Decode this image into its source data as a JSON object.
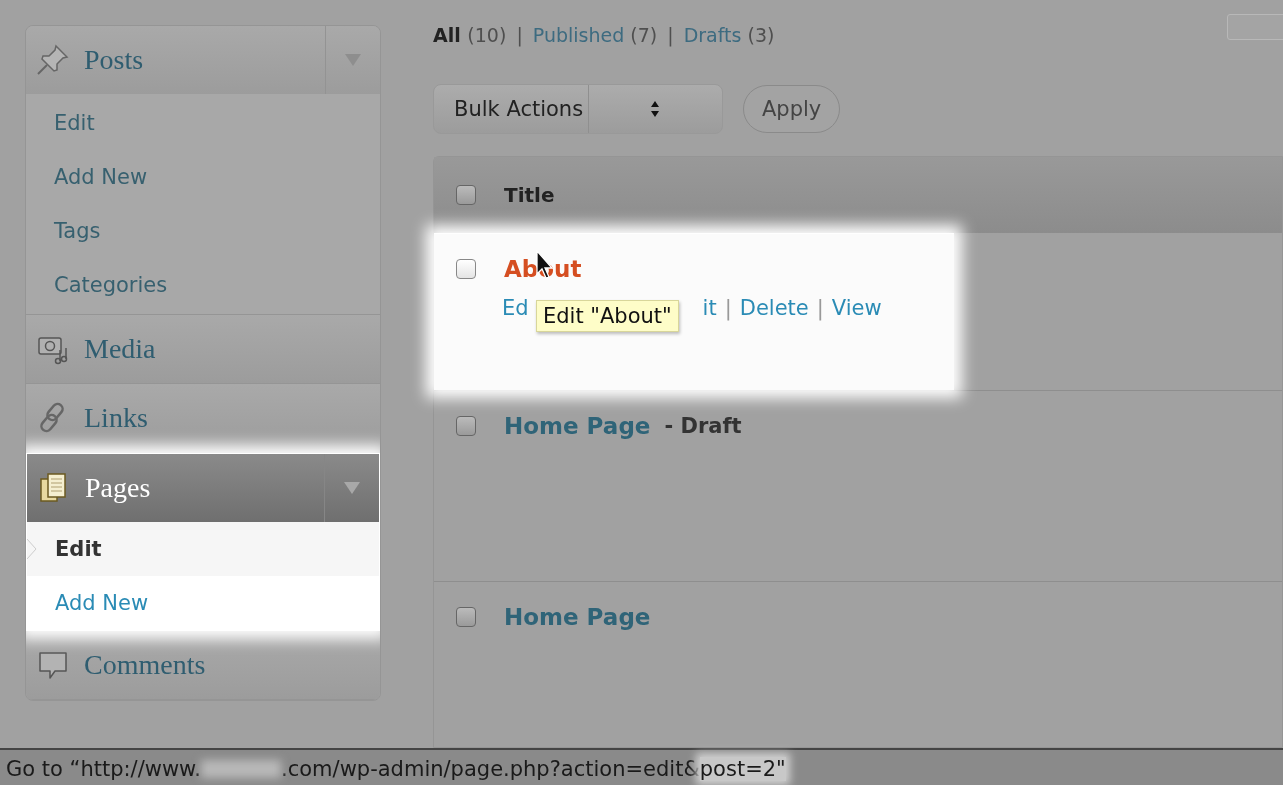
{
  "sidebar": {
    "groups": [
      {
        "label": "Posts",
        "expanded": true,
        "current": false,
        "highlighted": false,
        "children": [
          {
            "label": "Edit",
            "selected": false
          },
          {
            "label": "Add New",
            "selected": false
          },
          {
            "label": "Tags",
            "selected": false
          },
          {
            "label": "Categories",
            "selected": false
          }
        ]
      },
      {
        "label": "Media",
        "current": false,
        "highlighted": false
      },
      {
        "label": "Links",
        "current": false,
        "highlighted": false
      },
      {
        "label": "Pages",
        "expanded": true,
        "current": true,
        "highlighted": true,
        "children": [
          {
            "label": "Edit",
            "selected": true
          },
          {
            "label": "Add New",
            "selected": false
          }
        ]
      },
      {
        "label": "Comments",
        "current": false,
        "highlighted": false
      }
    ]
  },
  "filters": [
    {
      "kind": "link",
      "label": "All",
      "count": "(10)",
      "selected": true
    },
    {
      "kind": "sep",
      "label": "|"
    },
    {
      "kind": "link",
      "label": "Published",
      "count": "(7)",
      "selected": false
    },
    {
      "kind": "sep",
      "label": "|"
    },
    {
      "kind": "link",
      "label": "Drafts",
      "count": "(3)",
      "selected": false
    }
  ],
  "bulk_actions": {
    "value": "Bulk Actions"
  },
  "apply_button": "Apply",
  "table": {
    "header": {
      "label": "Title",
      "checked": false
    },
    "rows": [
      {
        "title": "About",
        "hovered": true,
        "highlighted": true,
        "checked": false,
        "actions": [
          {
            "kind": "link",
            "label": "Ed"
          },
          {
            "kind": "covered"
          },
          {
            "kind": "link",
            "label": "it"
          },
          {
            "kind": "sep",
            "label": "|"
          },
          {
            "kind": "link",
            "label": "Delete"
          },
          {
            "kind": "sep",
            "label": "|"
          },
          {
            "kind": "link",
            "label": "View"
          }
        ],
        "tooltip": "Edit \"About\""
      },
      {
        "title": "Home Page",
        "state": "- Draft",
        "hovered": false,
        "highlighted": false,
        "checked": false
      },
      {
        "title": "Home Page",
        "hovered": false,
        "highlighted": false,
        "checked": false
      }
    ]
  },
  "status_bar": {
    "segments": [
      {
        "kind": "text",
        "text": "Go to “http://www.",
        "highlighted": false
      },
      {
        "kind": "blurred"
      },
      {
        "kind": "text",
        "text": ".com/wp-admin/page.php?action=edit&",
        "highlighted": false
      },
      {
        "kind": "text",
        "text": "post=2\"",
        "highlighted": true
      }
    ]
  }
}
